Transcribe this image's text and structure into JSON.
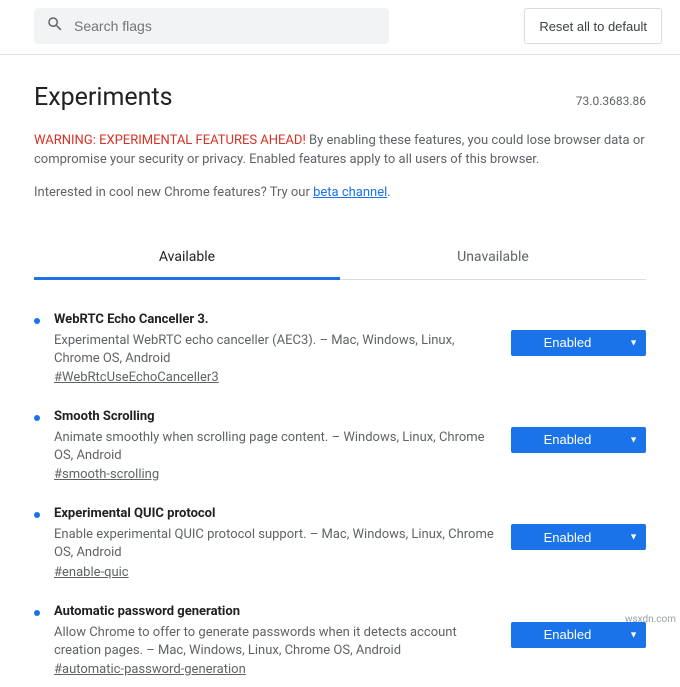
{
  "search": {
    "placeholder": "Search flags"
  },
  "reset_label": "Reset all to default",
  "page_title": "Experiments",
  "version": "73.0.3683.86",
  "warning": {
    "prefix": "WARNING: EXPERIMENTAL FEATURES AHEAD!",
    "body": " By enabling these features, you could lose browser data or compromise your security or privacy. Enabled features apply to all users of this browser."
  },
  "interested": {
    "pre": "Interested in cool new Chrome features? Try our ",
    "link": "beta channel",
    "post": "."
  },
  "tabs": {
    "available": "Available",
    "unavailable": "Unavailable"
  },
  "flags": [
    {
      "title": "WebRTC Echo Canceller 3.",
      "desc": "Experimental WebRTC echo canceller (AEC3). – Mac, Windows, Linux, Chrome OS, Android",
      "anchor": "#WebRtcUseEchoCanceller3",
      "state": "Enabled"
    },
    {
      "title": "Smooth Scrolling",
      "desc": "Animate smoothly when scrolling page content. – Windows, Linux, Chrome OS, Android",
      "anchor": "#smooth-scrolling",
      "state": "Enabled"
    },
    {
      "title": "Experimental QUIC protocol",
      "desc": "Enable experimental QUIC protocol support. – Mac, Windows, Linux, Chrome OS, Android",
      "anchor": "#enable-quic",
      "state": "Enabled"
    },
    {
      "title": "Automatic password generation",
      "desc": "Allow Chrome to offer to generate passwords when it detects account creation pages. – Mac, Windows, Linux, Chrome OS, Android",
      "anchor": "#automatic-password-generation",
      "state": "Enabled"
    }
  ],
  "watermark": "wsxdn.com"
}
